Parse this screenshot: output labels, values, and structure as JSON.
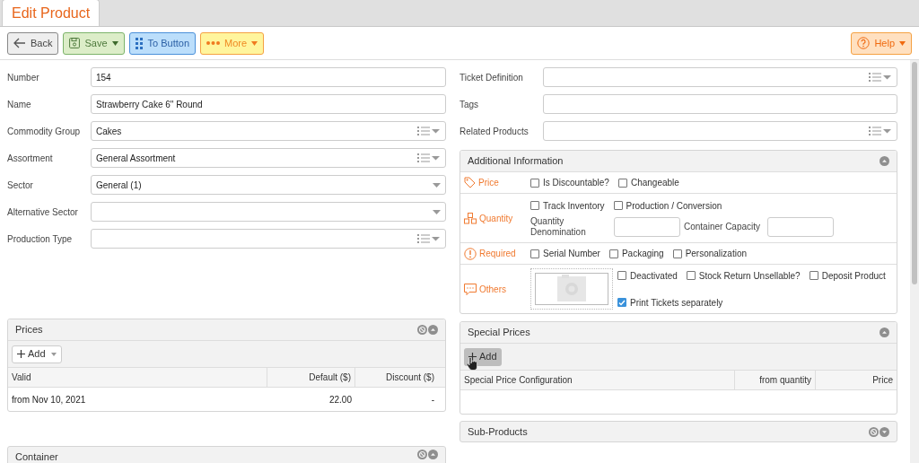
{
  "tab": {
    "title": "Edit Product"
  },
  "toolbar": {
    "buttons": [
      {
        "kind": "back",
        "label": "Back",
        "caret": false
      },
      {
        "kind": "save",
        "label": "Save",
        "caret": true
      },
      {
        "kind": "to_button",
        "label": "To Button",
        "caret": false
      },
      {
        "kind": "more",
        "label": "More",
        "caret": true
      }
    ],
    "help": {
      "label": "Help",
      "caret": true
    }
  },
  "left_fields": [
    {
      "label": "Number",
      "value": "154",
      "kind": "text"
    },
    {
      "label": "Name",
      "value": "Strawberry Cake 6\" Round",
      "kind": "text"
    },
    {
      "label": "Commodity Group",
      "value": "Cakes",
      "kind": "list"
    },
    {
      "label": "Assortment",
      "value": "General Assortment",
      "kind": "list"
    },
    {
      "label": "Sector",
      "value": "General (1)",
      "kind": "select"
    },
    {
      "label": "Alternative Sector",
      "kind": "select"
    },
    {
      "label": "Production Type",
      "kind": "list"
    }
  ],
  "right_fields": [
    {
      "label": "Ticket Definition",
      "kind": "list"
    },
    {
      "label": "Tags",
      "kind": "text"
    },
    {
      "label": "Related Products",
      "kind": "list"
    }
  ],
  "additional_information": {
    "title": "Additional Information",
    "expanded": true,
    "removable": false,
    "sections": [
      {
        "kind": "price",
        "label": "Price",
        "checkboxes": [
          {
            "label": "Is Discountable?",
            "checked": false
          },
          {
            "label": "Changeable",
            "checked": false
          }
        ]
      },
      {
        "kind": "quantity",
        "label": "Quantity",
        "checkboxes": [
          {
            "label": "Track Inventory",
            "checked": false
          },
          {
            "label": "Production / Conversion",
            "checked": false
          }
        ],
        "fields": [
          {
            "label": "Quantity Denomination"
          },
          {
            "label": "Container Capacity"
          }
        ]
      },
      {
        "kind": "required",
        "label": "Required",
        "checkboxes": [
          {
            "label": "Serial Number",
            "checked": false
          },
          {
            "label": "Packaging",
            "checked": false
          },
          {
            "label": "Personalization",
            "checked": false
          }
        ]
      },
      {
        "kind": "others",
        "label": "Others",
        "checkboxes": [
          {
            "label": "Deactivated",
            "checked": false
          },
          {
            "label": "Stock Return Unsellable?",
            "checked": false
          },
          {
            "label": "Deposit Product",
            "checked": false
          },
          {
            "label": "Print Tickets separately",
            "checked": true
          }
        ]
      }
    ]
  },
  "prices": {
    "title": "Prices",
    "expanded": true,
    "removable": true,
    "add_button": {
      "label": "Add",
      "caret": true,
      "hovered": false
    },
    "columns": [
      {
        "label": "Valid"
      },
      {
        "label": "Default ($)"
      },
      {
        "label": "Discount ($)"
      }
    ],
    "rows": [
      [
        "from Nov 10, 2021",
        "22.00",
        "-"
      ]
    ]
  },
  "special_prices": {
    "title": "Special Prices",
    "expanded": true,
    "removable": false,
    "add_button": {
      "label": "Add",
      "caret": false,
      "hovered": true
    },
    "columns": [
      {
        "label": "Special Price Configuration"
      },
      {
        "label": "from quantity"
      },
      {
        "label": "Price"
      }
    ]
  },
  "sub_products": {
    "title": "Sub-Products",
    "expanded": false,
    "removable": true
  },
  "container": {
    "title": "Container",
    "expanded": true,
    "removable": true
  }
}
